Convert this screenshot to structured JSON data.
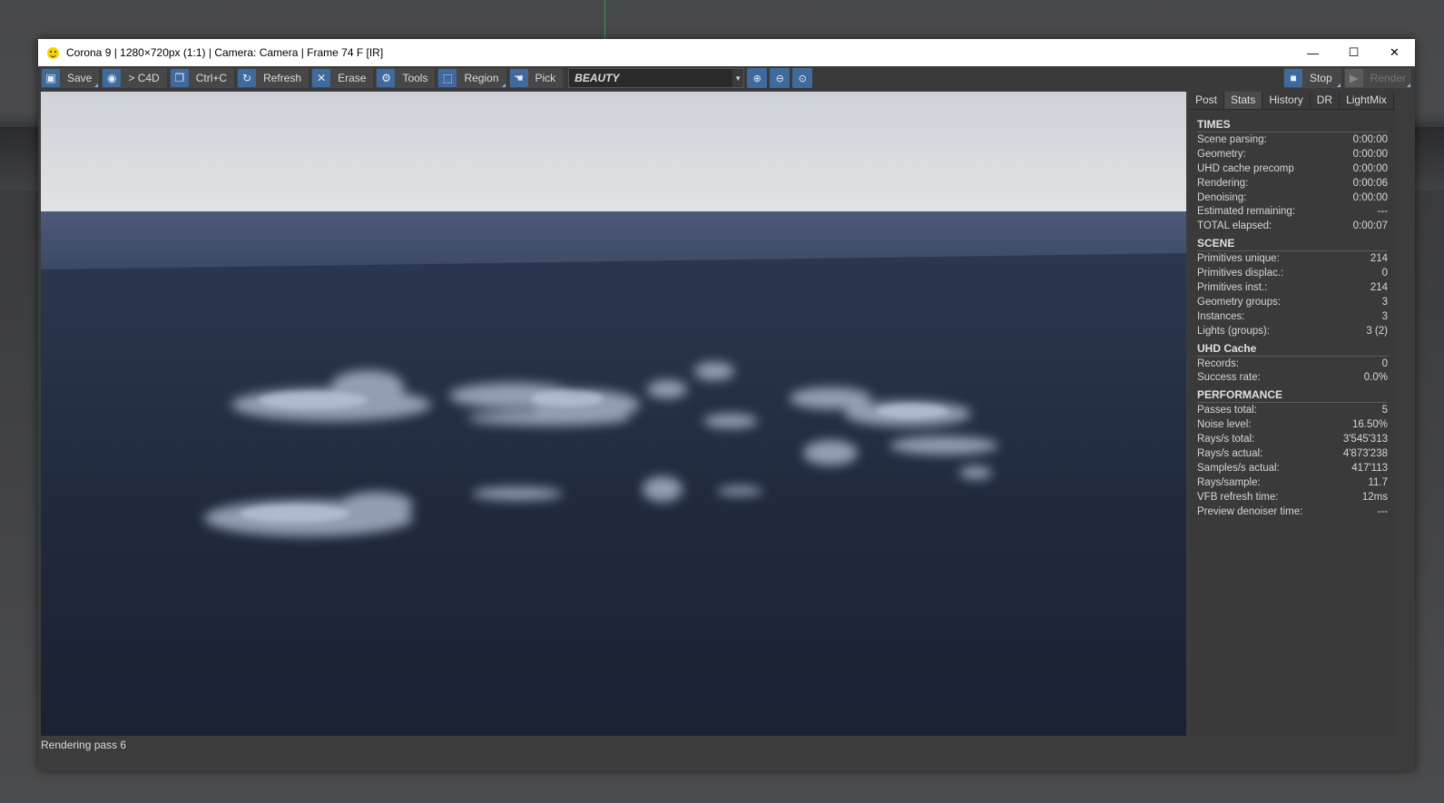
{
  "window": {
    "title": "Corona 9 | 1280×720px (1:1) | Camera: Camera | Frame 74 F [IR]",
    "controls": {
      "minimize": "—",
      "maximize": "☐",
      "close": "✕"
    }
  },
  "toolbar": {
    "save_label": "Save",
    "to_c4d_label": "> C4D",
    "copy_label": "Ctrl+C",
    "refresh_label": "Refresh",
    "erase_label": "Erase",
    "tools_label": "Tools",
    "region_label": "Region",
    "pick_label": "Pick",
    "render_pass": "BEAUTY",
    "stop_label": "Stop",
    "render_label": "Render",
    "icons": {
      "save": "floppy-icon",
      "to_c4d": "c4d-icon",
      "copy": "copy-icon",
      "refresh": "refresh-icon",
      "erase": "erase-icon",
      "tools": "gear-icon",
      "region": "region-icon",
      "pick": "hand-icon",
      "zoom_in": "zoom-in-icon",
      "zoom_out": "zoom-out-icon",
      "zoom_fit": "zoom-fit-icon",
      "stop": "stop-icon",
      "render": "play-icon"
    }
  },
  "side_panel": {
    "tabs": [
      "Post",
      "Stats",
      "History",
      "DR",
      "LightMix"
    ],
    "active_tab": "Stats",
    "sections": {
      "times": {
        "title": "TIMES",
        "rows": [
          {
            "label": "Scene parsing:",
            "value": "0:00:00"
          },
          {
            "label": "Geometry:",
            "value": "0:00:00"
          },
          {
            "label": "UHD cache precomp",
            "value": "0:00:00"
          },
          {
            "label": "Rendering:",
            "value": "0:00:06"
          },
          {
            "label": "Denoising:",
            "value": "0:00:00"
          },
          {
            "label": "Estimated remaining:",
            "value": "---"
          },
          {
            "label": "TOTAL elapsed:",
            "value": "0:00:07"
          }
        ]
      },
      "scene": {
        "title": "SCENE",
        "rows": [
          {
            "label": "Primitives unique:",
            "value": "214"
          },
          {
            "label": "Primitives displac.:",
            "value": "0"
          },
          {
            "label": "Primitives inst.:",
            "value": "214"
          },
          {
            "label": "Geometry groups:",
            "value": "3"
          },
          {
            "label": "Instances:",
            "value": "3"
          },
          {
            "label": "Lights (groups):",
            "value": "3 (2)"
          }
        ]
      },
      "uhd": {
        "title": "UHD Cache",
        "rows": [
          {
            "label": "Records:",
            "value": "0"
          },
          {
            "label": "Success rate:",
            "value": "0.0%"
          }
        ]
      },
      "performance": {
        "title": "PERFORMANCE",
        "rows": [
          {
            "label": "Passes total:",
            "value": "5"
          },
          {
            "label": "Noise level:",
            "value": "16.50%"
          },
          {
            "label": "Rays/s total:",
            "value": "3'545'313"
          },
          {
            "label": "Rays/s actual:",
            "value": "4'873'238"
          },
          {
            "label": "Samples/s actual:",
            "value": "417'113"
          },
          {
            "label": "Rays/sample:",
            "value": "11.7"
          },
          {
            "label": "VFB refresh time:",
            "value": "12ms"
          },
          {
            "label": "Preview denoiser time:",
            "value": "---"
          }
        ]
      }
    }
  },
  "status": {
    "text": "Rendering pass 6"
  },
  "colors": {
    "accent": "#3f6a9e",
    "sky": "#d9dbe0",
    "sea_far": "#4a5875",
    "sea_near": "#1c2433",
    "cloud": "#9aa6bd"
  }
}
